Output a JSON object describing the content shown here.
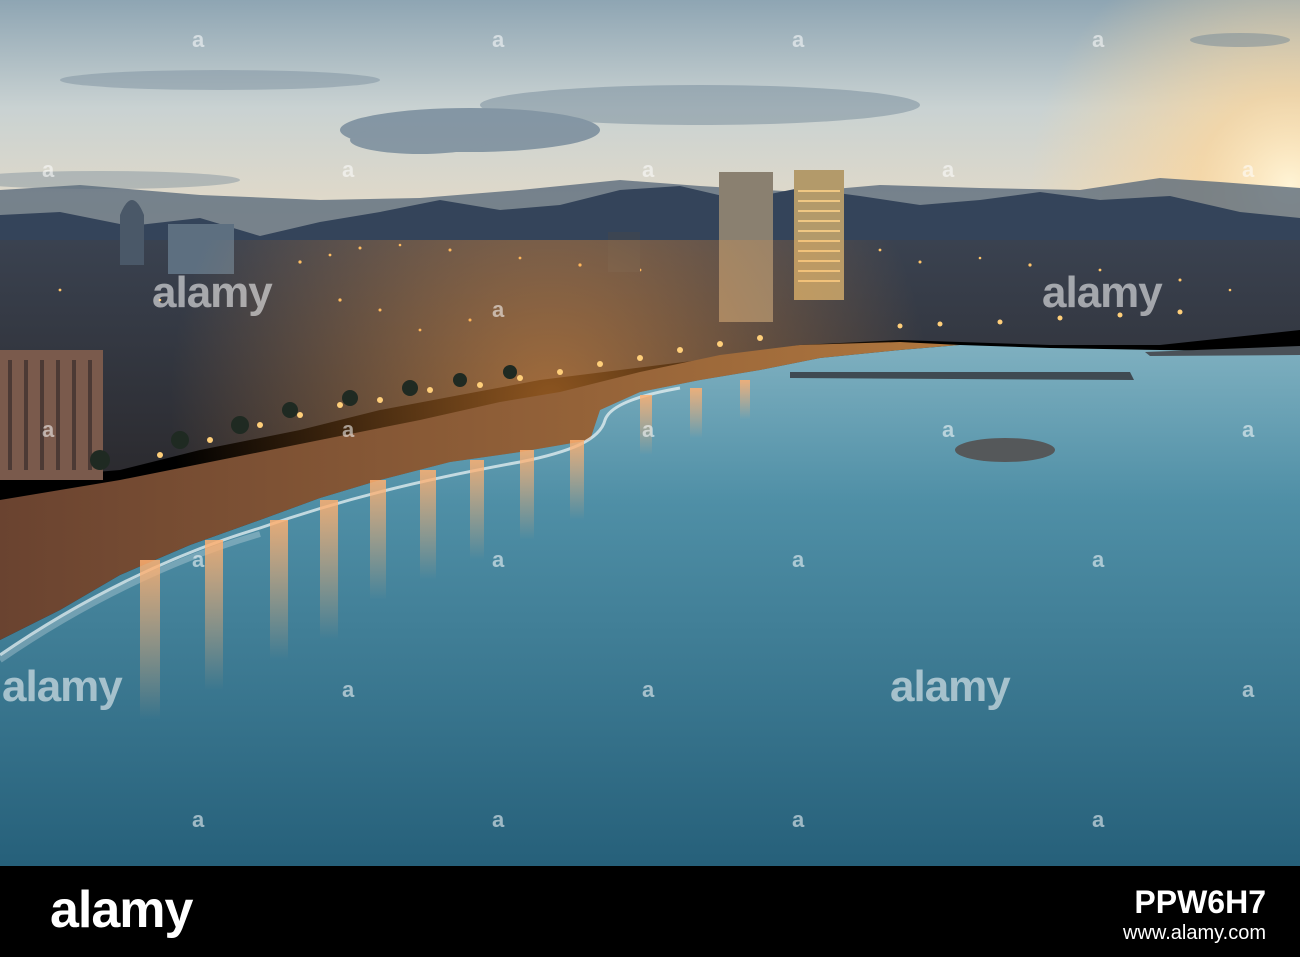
{
  "watermark": {
    "brand": "alamy",
    "letter": "a"
  },
  "footer": {
    "logo": "alamy",
    "image_id": "PPW6H7",
    "url": "www.alamy.com"
  },
  "colors": {
    "sky_top": "#8fa6b4",
    "sky_horizon": "#f0ddc0",
    "sun_glow": "#ffe9b8",
    "mountains": "#2c3c4e",
    "city": "#2a2f3a",
    "city_lights": "#ffb347",
    "beach": "#6b4a33",
    "sea": "#3e7c93",
    "sea_deep": "#2a6279",
    "footer_bg": "#000000"
  }
}
